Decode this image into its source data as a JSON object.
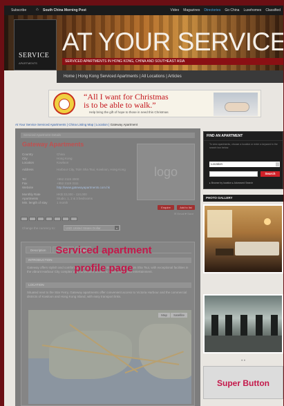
{
  "topbar": {
    "subscribe": "Subscribe",
    "home_icon": "home-icon",
    "brand": "South China Morning Post",
    "links": [
      "Video",
      "Magazines",
      "Directories",
      "Go China",
      "Luxehomes",
      "Classified"
    ],
    "active_link": "Directories"
  },
  "header": {
    "brand_title": "SERVICE",
    "brand_sub": "APARTMENTS",
    "title": "AT YOUR SERVICE",
    "subtitle": "SERVICED APARTMENTS IN HONG KONG, CHINA AND SOUTHEAST ASIA",
    "nav": "Home  |  Hong Kong Serviced Apartments  |  All Locations  |  Articles"
  },
  "ad": {
    "quote_line1": "“All I want for Christmas",
    "quote_line2": "is to be able to walk.”",
    "tagline": "Help bring the gift of hope to those in need this Christmas"
  },
  "breadcrumb": {
    "trail": "At Your Service Serviced Apartments | China Listing Map | Location | ",
    "current": "Gateway Apartment"
  },
  "profile": {
    "header": "Serviced Apartment Details",
    "name": "Gateway Apartments",
    "fields": [
      {
        "k": "Country",
        "v": "China",
        "link": false
      },
      {
        "k": "City",
        "v": "Hong Kong",
        "link": false
      },
      {
        "k": "Location",
        "v": "Kowloon",
        "link": false
      },
      {
        "k": "Address",
        "v": "Harbour City, Tsim Sha Tsui, Kowloon, Hong Kong",
        "link": false
      },
      {
        "k": "Tel",
        "v": "+852 2119 3000",
        "link": false
      },
      {
        "k": "Fax",
        "v": "+852 2119 3111",
        "link": false
      },
      {
        "k": "Website",
        "v": "http://www.gatewayapartments.com.hk",
        "link": true
      },
      {
        "k": "Monthly Rate",
        "v": "HK$ 33,000 - 110,000",
        "link": false
      },
      {
        "k": "Apartments",
        "v": "Studio, 1, 2 & 3 bedrooms",
        "link": false
      },
      {
        "k": "Min. length of stay",
        "v": "1 month",
        "link": false
      }
    ],
    "logo_text": "logo",
    "enquiry_btn": "Enquire",
    "add_btn": "Add to list",
    "share": "✉ Email  ♥ Save",
    "change_currency_label": "Change the currency to:",
    "currency_value": "USD United States Dollar"
  },
  "tabs": [
    "Description",
    "Facilities",
    "Map"
  ],
  "sections": {
    "intro_title": "INTRODUCTION",
    "intro_text": "Gateway offers stylish and comfortable serviced apartments in the heart of Tsim Sha Tsui, with exceptional facilities in the vibrant Harbour City complex and convenient access to retail, dining and entertainment.",
    "location_title": "LOCATION",
    "location_text": "Situated next to the Star Ferry, Gateway apartments offer convenient access to Victoria Harbour and the commercial districts of Kowloon and Hong Kong Island, with easy transport links."
  },
  "map": {
    "map_btn": "Map",
    "sat_btn": "Satellite"
  },
  "overlay": {
    "line1": "Serviced apartment",
    "line2": "profile page"
  },
  "sidebar": {
    "finder_title": "FIND AN APARTMENT",
    "finder_desc": "To view apartments, choose a location or enter a keyword in the search box below.",
    "location_select": "Location",
    "search_btn": "Search",
    "finder_links": "▸ Browse by location  ▸ Advanced Search",
    "gallery_title": "PHOTO GALLERY",
    "super_button": "Super Button"
  }
}
